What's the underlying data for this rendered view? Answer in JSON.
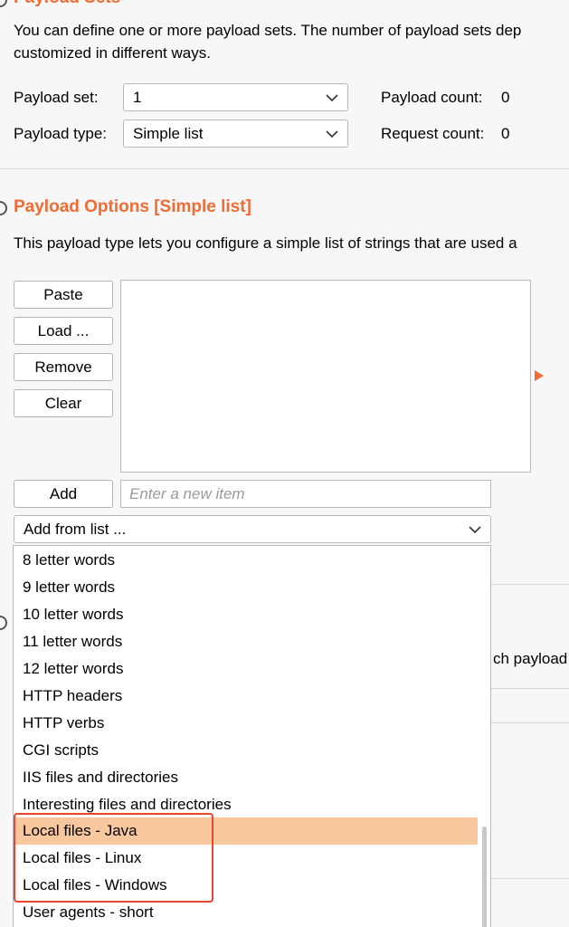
{
  "payload_sets": {
    "title": "Payload Sets",
    "description_line1": "You can define one or more payload sets. The number of payload sets dep",
    "description_line2": "customized in different ways.",
    "payload_set_label": "Payload set:",
    "payload_set_value": "1",
    "payload_type_label": "Payload type:",
    "payload_type_value": "Simple list",
    "payload_count_label": "Payload count:",
    "payload_count_value": "0",
    "request_count_label": "Request count:",
    "request_count_value": "0"
  },
  "payload_options": {
    "title": "Payload Options [Simple list]",
    "description": "This payload type lets you configure a simple list of strings that are used a",
    "buttons": {
      "paste": "Paste",
      "load": "Load ...",
      "remove": "Remove",
      "clear": "Clear",
      "add": "Add"
    },
    "new_item_placeholder": "Enter a new item",
    "add_from_list_label": "Add from list ..."
  },
  "background_peek": {
    "text": "ch payload"
  },
  "dropdown": {
    "items": [
      "8 letter words",
      "9 letter words",
      "10 letter words",
      "11 letter words",
      "12 letter words",
      "HTTP headers",
      "HTTP verbs",
      "CGI scripts",
      "IIS files and directories",
      "Interesting files and directories",
      "Local files - Java",
      "Local files - Linux",
      "Local files - Windows",
      "User agents - short"
    ],
    "selected_item": "Local files - Java"
  },
  "colors": {
    "accent": "#f06c34",
    "selection": "#f9c79e",
    "annotation": "#e8462e"
  },
  "icons": {
    "select_arrow": "chevron-down-icon",
    "expand_arrow": "triangle-right-icon"
  }
}
